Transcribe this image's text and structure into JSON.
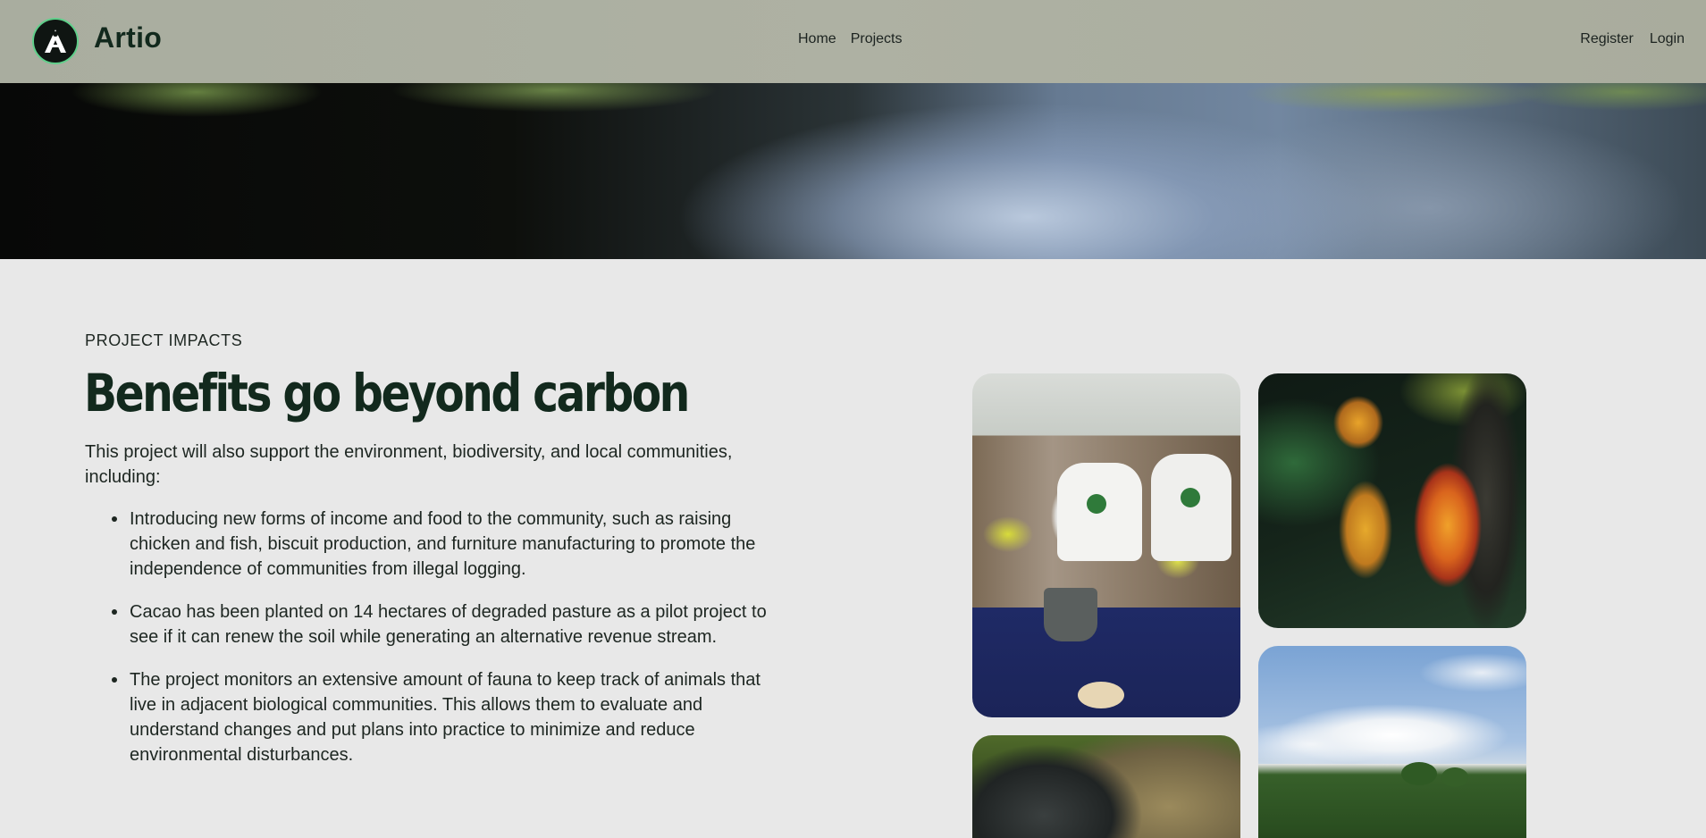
{
  "header": {
    "brand": "Artio",
    "nav": [
      "Home",
      "Projects"
    ],
    "auth": [
      "Register",
      "Login"
    ]
  },
  "section": {
    "eyebrow": "PROJECT IMPACTS",
    "headline": "Benefits go beyond carbon",
    "intro": "This project will also support the environment, biodiversity, and local communities, including:",
    "bullets": [
      "Introducing new forms of income and food to the community, such as raising chicken and fish, biscuit production, and furniture manufacturing to promote the independence of communities from illegal logging.",
      "Cacao has been planted on 14 hectares of degraded pasture as a pilot project to see if it can renew the soil while generating an alternative revenue stream.",
      "The project monitors an extensive amount of fauna to keep track of animals that live in adjacent biological communities. This allows them to evaluate and understand changes and put plans into practice to minimize and reduce environmental disturbances."
    ]
  },
  "colors": {
    "background": "#e8e8e8",
    "heading": "#12291d",
    "navbar": "#aeb1a3",
    "logo_ring": "#5fcf8a"
  },
  "icons": {
    "logo": "artio-logo-icon"
  }
}
